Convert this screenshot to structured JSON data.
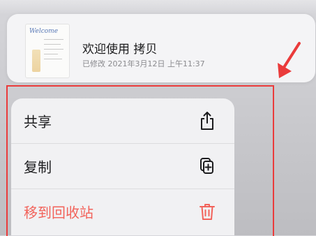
{
  "file": {
    "name": "欢迎使用 拷贝",
    "modified": "已修改 2021年3月12日 上午11:37",
    "thumbnail_title": "Welcome"
  },
  "menu": {
    "items": [
      {
        "label": "共享",
        "icon": "share-icon",
        "destructive": false
      },
      {
        "label": "复制",
        "icon": "duplicate-icon",
        "destructive": false
      },
      {
        "label": "移到回收站",
        "icon": "trash-icon",
        "destructive": true
      }
    ]
  },
  "annotation": {
    "color": "#ea3b3b"
  },
  "colors": {
    "destructive": "#f2625a",
    "text": "#1c1c1e",
    "secondary_text": "#8a8a8e"
  }
}
